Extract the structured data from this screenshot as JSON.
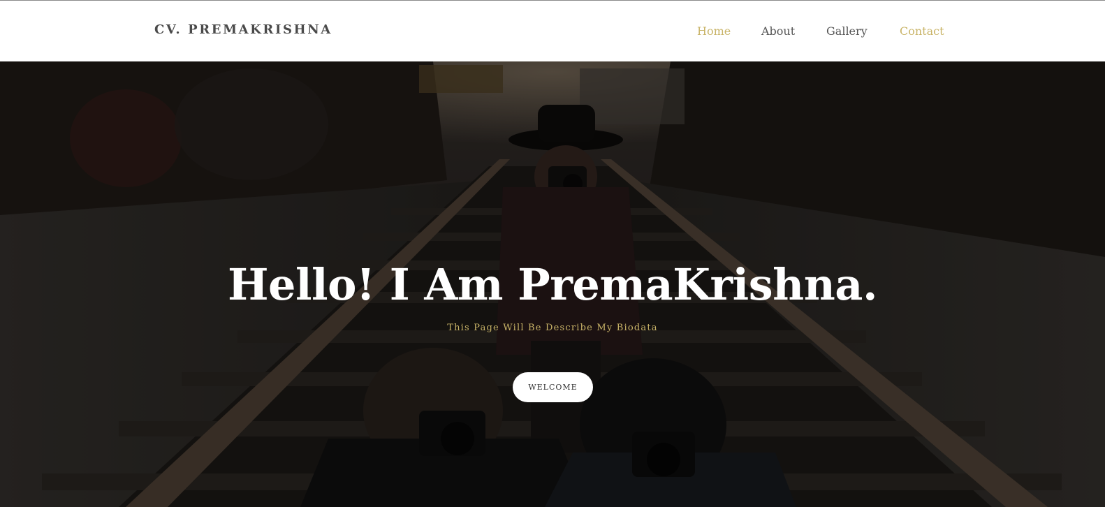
{
  "navbar": {
    "brand": "CV. PREMAKRISHNA",
    "items": [
      {
        "label": "Home",
        "active": true
      },
      {
        "label": "About",
        "active": false
      },
      {
        "label": "Gallery",
        "active": false
      },
      {
        "label": "Contact",
        "active": true
      }
    ]
  },
  "hero": {
    "title": "Hello! I Am PremaKrishna.",
    "subtitle": "This Page Will Be Describe My Biodata",
    "button_label": "WELCOME",
    "background_description_icon": "photo-background"
  },
  "colors": {
    "accent": "#c9b468",
    "nav_text": "#555555",
    "brand_text": "#4a4a4a",
    "hero_overlay": "#1a1715"
  }
}
